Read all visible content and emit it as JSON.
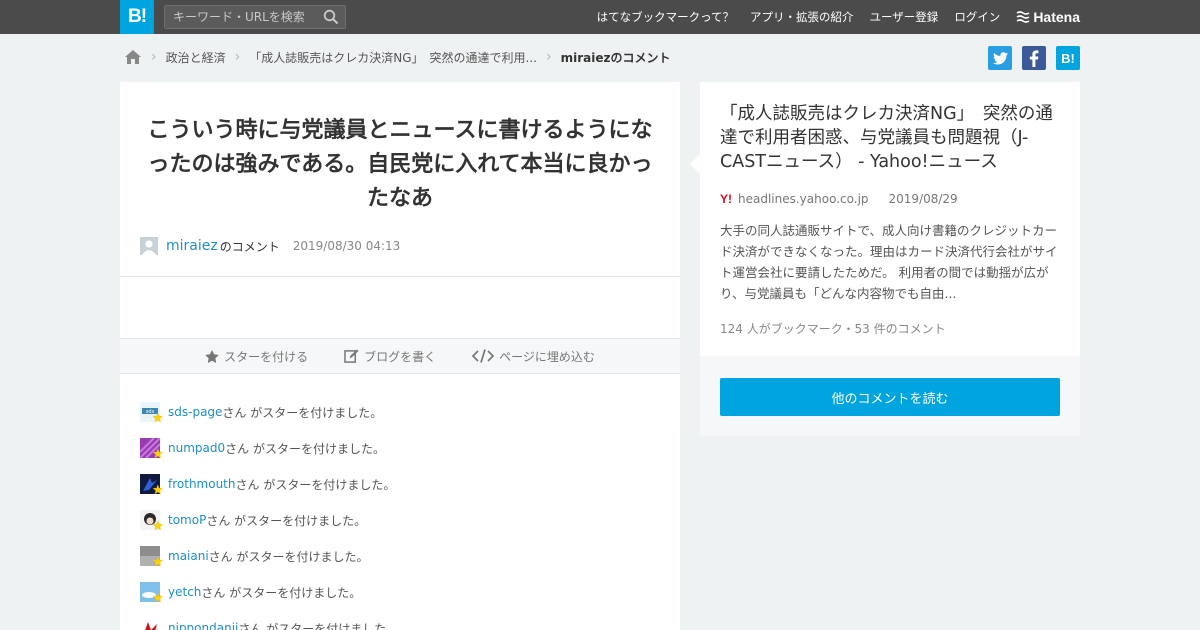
{
  "header": {
    "logo": "B!",
    "search_placeholder": "キーワード・URLを検索",
    "nav": [
      "はてなブックマークって？",
      "アプリ・拡張の紹介",
      "ユーザー登録",
      "ログイン"
    ],
    "hatena_label": "Hatena"
  },
  "breadcrumb": {
    "items": [
      "政治と経済",
      "「成人誌販売はクレカ決済NG」　突然の通達で利用...",
      "miraiezのコメント"
    ]
  },
  "share": {
    "buttons": [
      "twitter-icon",
      "facebook-icon",
      "hatena-bookmark-icon"
    ],
    "hatena_label": "B!",
    "colors": {
      "twitter": "#2b9de2",
      "facebook": "#3b5998",
      "hatena": "#00a4de"
    }
  },
  "comment": {
    "text": "こういう時に与党議員とニュースに書けるようになったのは強みである。自民党に入れて本当に良かったなあ",
    "user": "miraiez",
    "suffix": "のコメント",
    "date": "2019/08/30 04:13"
  },
  "actions": {
    "star": "スターを付ける",
    "blog": "ブログを書く",
    "embed": "ページに埋め込む"
  },
  "stars": [
    {
      "user": "sds-page",
      "text": "さん がスターを付けました。"
    },
    {
      "user": "numpad0",
      "text": "さん がスターを付けました。"
    },
    {
      "user": "frothmouth",
      "text": "さん がスターを付けました。"
    },
    {
      "user": "tomoP",
      "text": "さん がスターを付けました。"
    },
    {
      "user": "maiani",
      "text": "さん がスターを付けました。"
    },
    {
      "user": "yetch",
      "text": "さん がスターを付けました。"
    },
    {
      "user": "nippondanji",
      "text": "さん がスターを付けました。"
    }
  ],
  "entry": {
    "title": "「成人誌販売はクレカ決済NG」　突然の通達で利用者困惑、与党議員も問題視（J-CASTニュース） - Yahoo!ニュース",
    "favicon": "Y!",
    "domain": "headlines.yahoo.co.jp",
    "date": "2019/08/29",
    "description": "大手の同人誌通販サイトで、成人向け書籍のクレジットカード決済ができなくなった。理由はカード決済代行会社がサイト運営会社に要請したためだ。 利用者の間では動揺が広がり、与党議員も「どんな内容物でも自由...",
    "count": "124 人がブックマーク・53 件のコメント"
  },
  "readmore": "他のコメントを読む"
}
